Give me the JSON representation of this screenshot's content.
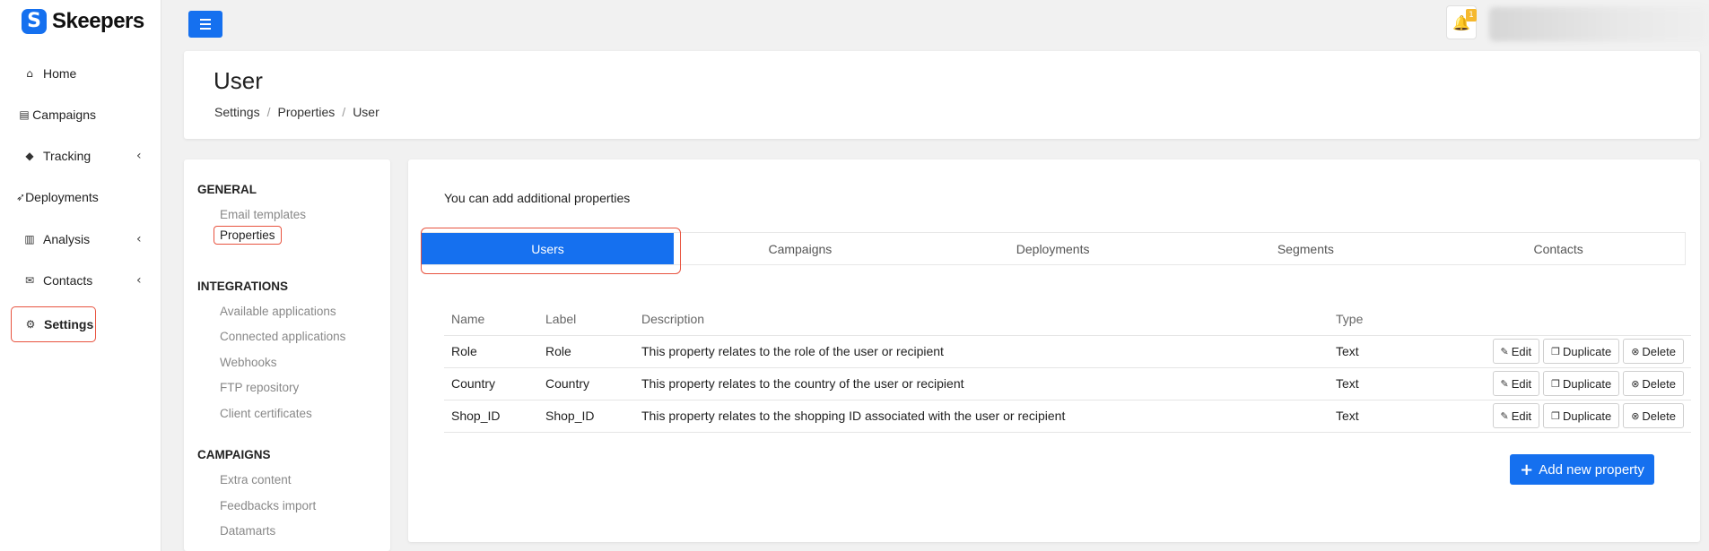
{
  "app": {
    "logo_mark": "S",
    "brand": "Skeepers"
  },
  "sidebar": {
    "items": [
      {
        "label": "Home",
        "icon": "home-icon",
        "glyph": "⌂"
      },
      {
        "label": "Campaigns",
        "icon": "file-icon",
        "glyph": "▤"
      },
      {
        "label": "Tracking",
        "icon": "tag-icon",
        "glyph": "◆",
        "chevron": "‹"
      },
      {
        "label": "Deployments",
        "icon": "rocket-icon",
        "glyph": "➶"
      },
      {
        "label": "Analysis",
        "icon": "bar-chart-icon",
        "glyph": "▥",
        "chevron": "‹"
      },
      {
        "label": "Contacts",
        "icon": "envelope-icon",
        "glyph": "✉",
        "chevron": "‹"
      },
      {
        "label": "Settings",
        "icon": "gear-icon",
        "glyph": "⚙"
      }
    ]
  },
  "topbar": {
    "notification_count": "1",
    "bell_glyph": "🔔"
  },
  "header": {
    "title": "User",
    "breadcrumb": [
      "Settings",
      "Properties",
      "User"
    ],
    "separator": "/"
  },
  "settings_menu": {
    "sections": [
      {
        "title": "GENERAL",
        "links": [
          "Email templates",
          "Properties"
        ]
      },
      {
        "title": "INTEGRATIONS",
        "links": [
          "Available applications",
          "Connected applications",
          "Webhooks",
          "FTP repository",
          "Client certificates"
        ]
      },
      {
        "title": "CAMPAIGNS",
        "links": [
          "Extra content",
          "Feedbacks import",
          "Datamarts"
        ]
      }
    ]
  },
  "main": {
    "intro": "You can add additional properties",
    "tabs": [
      "Users",
      "Campaigns",
      "Deployments",
      "Segments",
      "Contacts"
    ],
    "table": {
      "headers": [
        "Name",
        "Label",
        "Description",
        "Type"
      ],
      "rows": [
        {
          "name": "Role",
          "label": "Role",
          "description": "This property relates to the role of the user or recipient",
          "type": "Text"
        },
        {
          "name": "Country",
          "label": "Country",
          "description": "This property relates to the country of the user or recipient",
          "type": "Text"
        },
        {
          "name": "Shop_ID",
          "label": "Shop_ID",
          "description": "This property relates to the shopping ID associated with the user or recipient",
          "type": "Text"
        }
      ],
      "actions": {
        "edit": "Edit",
        "duplicate": "Duplicate",
        "delete": "Delete"
      }
    },
    "add_button": "Add new property"
  },
  "colors": {
    "accent": "#1570ef",
    "highlight": "#e8533f",
    "badge": "#f5b82e"
  }
}
